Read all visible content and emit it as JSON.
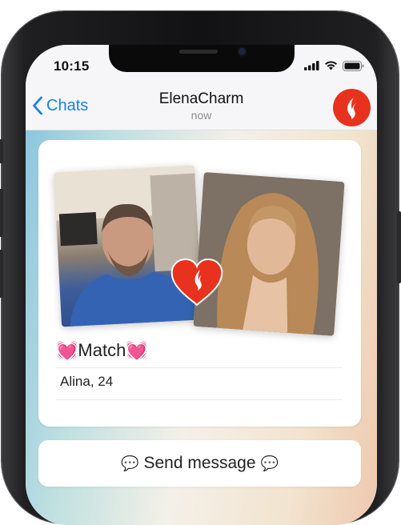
{
  "status_bar": {
    "time": "10:15"
  },
  "nav": {
    "back_label": "Chats",
    "title": "ElenaCharm",
    "subtitle": "now"
  },
  "card": {
    "match_text": "Match",
    "name_age": "Alina, 24"
  },
  "send": {
    "label": "Send message"
  },
  "colors": {
    "brand_red": "#e8321e",
    "link_blue": "#1b7fe6"
  },
  "icons": [
    "signal-icon",
    "wifi-icon",
    "battery-icon",
    "chevron-left-icon",
    "brand-logo-icon",
    "heart-icon",
    "speech-bubble-icon"
  ]
}
